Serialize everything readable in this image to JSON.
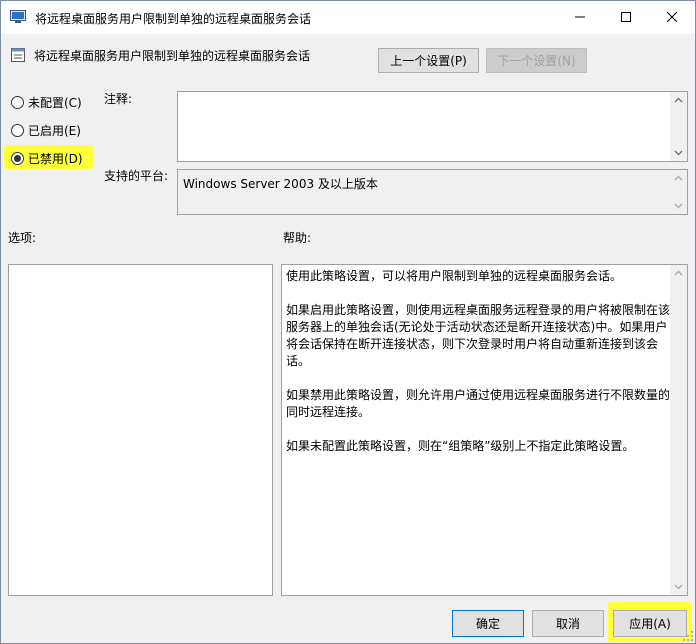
{
  "window": {
    "title": "将远程桌面服务用户限制到单独的远程桌面服务会话"
  },
  "header": {
    "policy_title": "将远程桌面服务用户限制到单独的远程桌面服务会话",
    "prev_label": "上一个设置(P)",
    "next_label": "下一个设置(N)"
  },
  "state": {
    "options": [
      {
        "label": "未配置(C)",
        "selected": false
      },
      {
        "label": "已启用(E)",
        "selected": false
      },
      {
        "label": "已禁用(D)",
        "selected": true
      }
    ]
  },
  "comment": {
    "label": "注释:",
    "value": ""
  },
  "platform": {
    "label": "支持的平台:",
    "value": "Windows Server 2003 及以上版本"
  },
  "options_panel": {
    "label": "选项:"
  },
  "help_panel": {
    "label": "帮助:",
    "paragraphs": [
      "使用此策略设置，可以将用户限制到单独的远程桌面服务会话。",
      "如果启用此策略设置，则使用远程桌面服务远程登录的用户将被限制在该服务器上的单独会话(无论处于活动状态还是断开连接状态)中。如果用户将会话保持在断开连接状态，则下次登录时用户将自动重新连接到该会话。",
      "如果禁用此策略设置，则允许用户通过使用远程桌面服务进行不限数量的同时远程连接。",
      "如果未配置此策略设置，则在“组策略”级别上不指定此策略设置。"
    ]
  },
  "footer": {
    "ok_label": "确定",
    "cancel_label": "取消",
    "apply_label": "应用(A)"
  },
  "colors": {
    "highlight": "#ffff3a",
    "accent": "#0078d7"
  }
}
